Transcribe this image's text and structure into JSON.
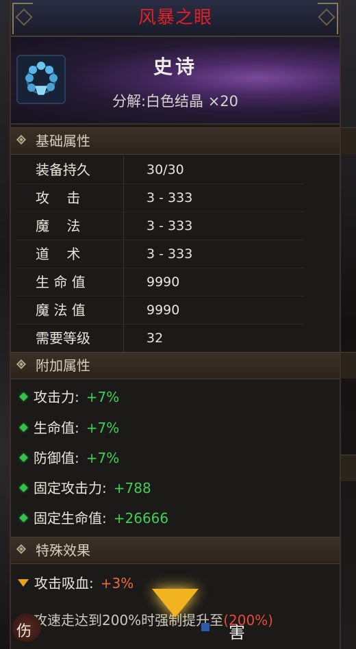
{
  "item": {
    "name": "风暴之眼",
    "rarity": "史诗",
    "decompose": "分解:白色结晶 ×20",
    "icon": "bracelet-icon"
  },
  "sections": {
    "basic": "基础属性",
    "extra": "附加属性",
    "special": "特殊效果"
  },
  "basic_attrs": [
    {
      "name": "装备持久",
      "value": "30/30"
    },
    {
      "name": "攻    击",
      "value": "3 - 333"
    },
    {
      "name": "魔    法",
      "value": "3 - 333"
    },
    {
      "name": "道    术",
      "value": "3 - 333"
    },
    {
      "name": "生 命 值",
      "value": "9990"
    },
    {
      "name": "魔 法 值",
      "value": "9990"
    },
    {
      "name": "需要等级",
      "value": "32"
    }
  ],
  "extra_attrs": [
    {
      "name": "攻击力:",
      "value": "+7%"
    },
    {
      "name": "生命值:",
      "value": "+7%"
    },
    {
      "name": "防御值:",
      "value": "+7%"
    },
    {
      "name": "固定攻击力:",
      "value": "+788"
    },
    {
      "name": "固定生命值:",
      "value": "+26666"
    }
  ],
  "special_effects": [
    {
      "name": "攻击吸血:",
      "value": "+3%"
    },
    {
      "text": "攻速走达到200%时强制提升至",
      "value": "(200%)"
    }
  ],
  "bottom": {
    "left_label": "伤",
    "right_label": "害"
  },
  "colors": {
    "title": "#e0202a",
    "bonus": "#3ed152",
    "special": "#e86a3a",
    "arrow": "#f2b320"
  }
}
